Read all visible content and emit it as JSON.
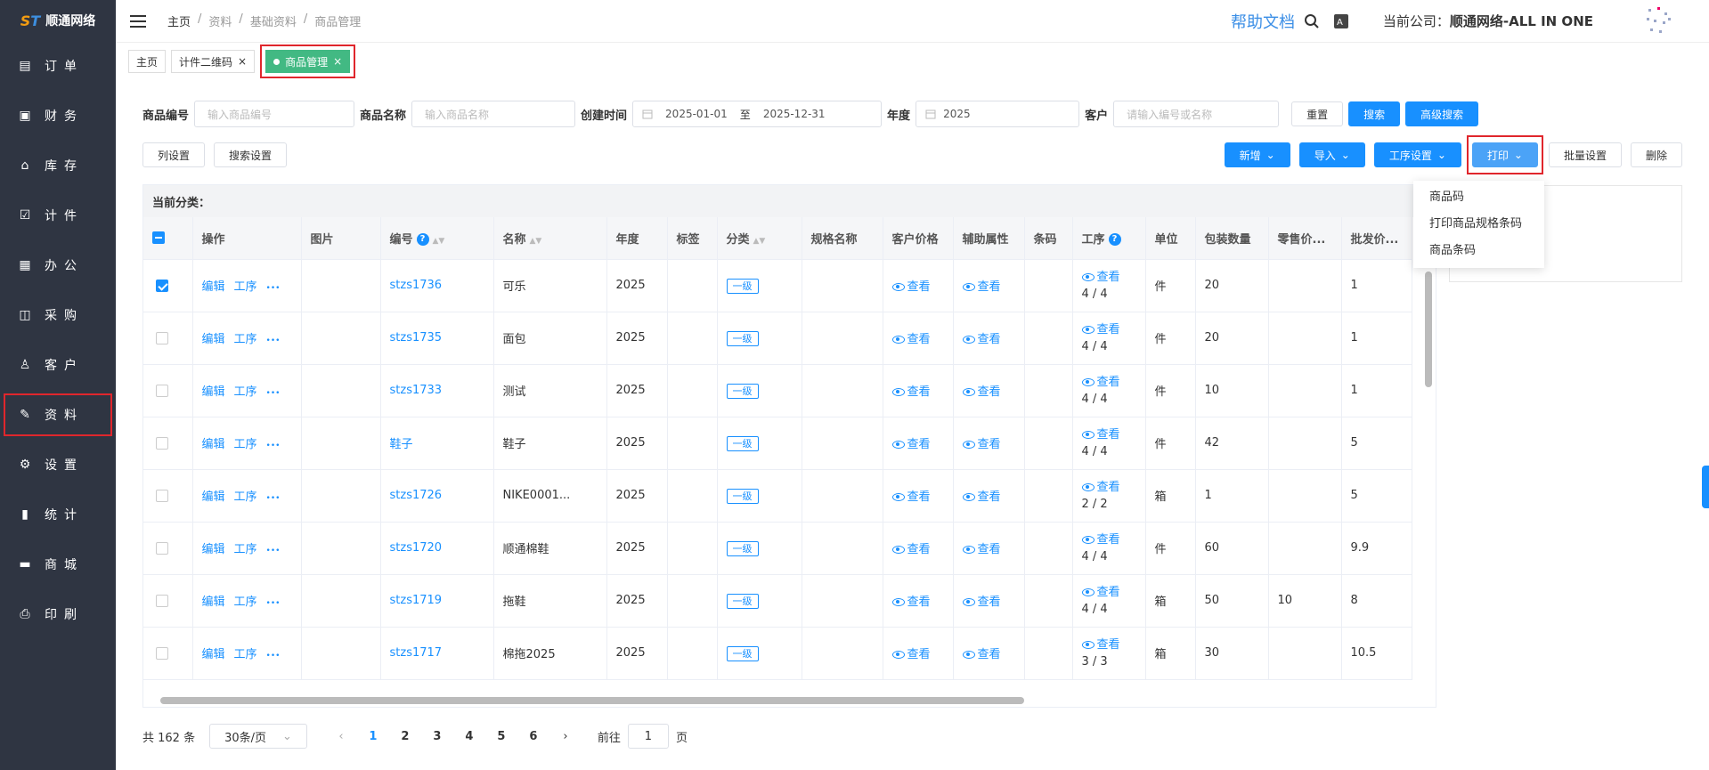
{
  "brand": {
    "name": "顺通网络"
  },
  "sidebar": {
    "items": [
      {
        "icon": "file-icon",
        "label": "订单"
      },
      {
        "icon": "wallet-icon",
        "label": "财务"
      },
      {
        "icon": "home-icon",
        "label": "库存"
      },
      {
        "icon": "clipboard-icon",
        "label": "计件"
      },
      {
        "icon": "calendar-icon",
        "label": "办公"
      },
      {
        "icon": "bag-icon",
        "label": "采购"
      },
      {
        "icon": "user-icon",
        "label": "客户"
      },
      {
        "icon": "edit-icon",
        "label": "资料",
        "highlighted": true
      },
      {
        "icon": "gear-icon",
        "label": "设置"
      },
      {
        "icon": "bar-chart-icon",
        "label": "统计"
      },
      {
        "icon": "shop-icon",
        "label": "商城"
      },
      {
        "icon": "printer-icon",
        "label": "印刷"
      }
    ]
  },
  "breadcrumb": [
    "主页",
    "/",
    "资料",
    "/",
    "基础资料",
    "/",
    "商品管理"
  ],
  "header": {
    "help": "帮助文档",
    "company_prefix": "当前公司：",
    "company": "顺通网络-ALL IN ONE"
  },
  "tabs": [
    {
      "label": "主页"
    },
    {
      "label": "计件二维码",
      "close": "×"
    },
    {
      "label": "商品管理",
      "close": "×",
      "active": true
    }
  ],
  "filters": {
    "code_label": "商品编号",
    "code_ph": "输入商品编号",
    "name_label": "商品名称",
    "name_ph": "输入商品名称",
    "date_label": "创建时间",
    "date_from": "2025-01-01",
    "date_sep": "至",
    "date_to": "2025-12-31",
    "year_label": "年度",
    "year": "2025",
    "cust_label": "客户",
    "cust_ph": "请输入编号或名称",
    "reset": "重置",
    "search": "搜索",
    "adv": "高级搜索"
  },
  "toolbar": {
    "col_settings": "列设置",
    "search_settings": "搜索设置",
    "add": "新增",
    "import": "导入",
    "process": "工序设置",
    "print": "打印",
    "batch": "批量设置",
    "delete": "删除"
  },
  "print_menu": [
    "商品码",
    "打印商品规格条码",
    "商品条码"
  ],
  "table": {
    "category_label": "当前分类：",
    "headers": [
      "操作",
      "图片",
      "编号",
      "名称",
      "年度",
      "标签",
      "分类",
      "规格名称",
      "客户价格",
      "辅助属性",
      "条码",
      "工序",
      "单位",
      "包装数量",
      "零售价...",
      "批发价..."
    ],
    "ops": [
      "编辑",
      "工序",
      "•••"
    ],
    "view": "查看",
    "rows": [
      {
        "checked": true,
        "code": "stzs1736",
        "name": "可乐",
        "year": "2025",
        "cat": "一级",
        "proc": "4 / 4",
        "unit": "件",
        "pack": "20",
        "retail": "",
        "whole": "1"
      },
      {
        "checked": false,
        "code": "stzs1735",
        "name": "面包",
        "year": "2025",
        "cat": "一级",
        "proc": "4 / 4",
        "unit": "件",
        "pack": "20",
        "retail": "",
        "whole": "1"
      },
      {
        "checked": false,
        "code": "stzs1733",
        "name": "测试",
        "year": "2025",
        "cat": "一级",
        "proc": "4 / 4",
        "unit": "件",
        "pack": "10",
        "retail": "",
        "whole": "1"
      },
      {
        "checked": false,
        "code": "鞋子",
        "name": "鞋子",
        "year": "2025",
        "cat": "一级",
        "proc": "4 / 4",
        "unit": "件",
        "pack": "42",
        "retail": "",
        "whole": "5"
      },
      {
        "checked": false,
        "code": "stzs1726",
        "name": "NIKE0001...",
        "year": "2025",
        "cat": "一级",
        "proc": "2 / 2",
        "unit": "箱",
        "pack": "1",
        "retail": "",
        "whole": "5"
      },
      {
        "checked": false,
        "code": "stzs1720",
        "name": "顺通棉鞋",
        "year": "2025",
        "cat": "一级",
        "proc": "4 / 4",
        "unit": "件",
        "pack": "60",
        "retail": "",
        "whole": "9.9"
      },
      {
        "checked": false,
        "code": "stzs1719",
        "name": "拖鞋",
        "year": "2025",
        "cat": "一级",
        "proc": "4 / 4",
        "unit": "箱",
        "pack": "50",
        "retail": "10",
        "whole": "8"
      },
      {
        "checked": false,
        "code": "stzs1717",
        "name": "棉拖2025",
        "year": "2025",
        "cat": "一级",
        "proc": "3 / 3",
        "unit": "箱",
        "pack": "30",
        "retail": "",
        "whole": "10.5"
      }
    ]
  },
  "pager": {
    "total": "共 162 条",
    "size": "30条/页",
    "pages": [
      "1",
      "2",
      "3",
      "4",
      "5",
      "6"
    ],
    "goto": "前往",
    "goto_val": "1",
    "page_unit": "页"
  },
  "colors": {
    "primary": "#1890ff",
    "sidebar": "#2f3542",
    "active_tab": "#42b983",
    "highlight": "#e0262c"
  }
}
